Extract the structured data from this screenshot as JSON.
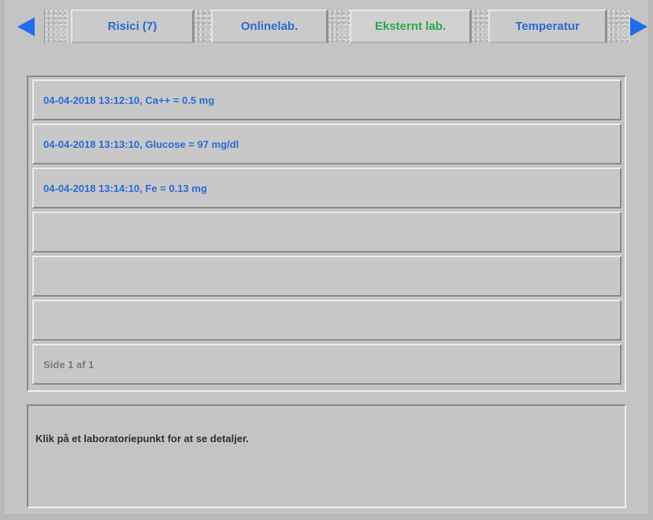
{
  "tabs": [
    {
      "label": "Risici (7)",
      "active": false
    },
    {
      "label": "Onlinelab.",
      "active": false
    },
    {
      "label": "Eksternt lab.",
      "active": true
    },
    {
      "label": "Temperatur",
      "active": false
    }
  ],
  "navigation": {
    "left_icon": "arrow-left-icon",
    "right_icon": "arrow-right-icon"
  },
  "lab_list": {
    "items": [
      "04-04-2018 13:12:10, Ca++ = 0.5 mg",
      "04-04-2018 13:13:10, Glucose = 97 mg/dl",
      "04-04-2018 13:14:10, Fe = 0.13 mg",
      "",
      "",
      ""
    ],
    "page_indicator": "Side 1 af 1"
  },
  "details": {
    "hint": "Klik på et laboratoriepunkt for at se detaljer."
  },
  "colors": {
    "tab_text": "#2a6bd6",
    "active_tab_text": "#2ea84a",
    "arrow": "#1f6cf0",
    "background": "#c4c4c4"
  }
}
